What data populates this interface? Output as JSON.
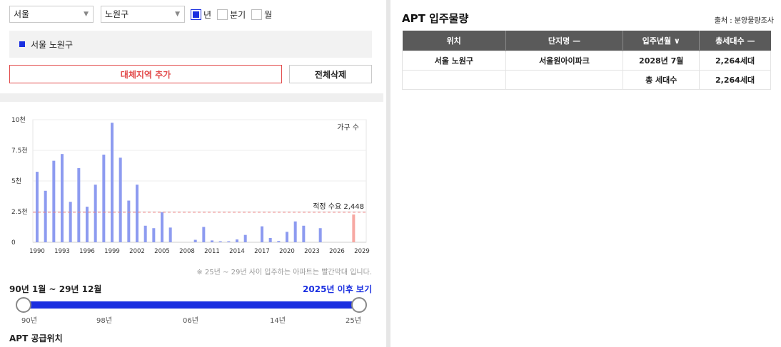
{
  "filters": {
    "province": "서울",
    "district": "노원구",
    "period_options": [
      {
        "label": "년",
        "checked": true
      },
      {
        "label": "분기",
        "checked": false
      },
      {
        "label": "월",
        "checked": false
      }
    ]
  },
  "selected_region": "서울 노원구",
  "buttons": {
    "add_region": "대체지역 추가",
    "delete_all": "전체삭제"
  },
  "chart_data": {
    "type": "bar",
    "legend_label": "가구 수",
    "yticks": [
      "10천",
      "7.5천",
      "5천",
      "2.5천",
      "0"
    ],
    "ylim": [
      0,
      10000
    ],
    "xticks": [
      "1990",
      "1993",
      "1996",
      "1999",
      "2002",
      "2005",
      "2008",
      "2011",
      "2014",
      "2017",
      "2020",
      "2023",
      "2026",
      "2029"
    ],
    "x": [
      1990,
      1991,
      1992,
      1993,
      1994,
      1995,
      1996,
      1997,
      1998,
      1999,
      2000,
      2001,
      2002,
      2003,
      2004,
      2005,
      2006,
      2007,
      2008,
      2009,
      2010,
      2011,
      2012,
      2013,
      2014,
      2015,
      2016,
      2017,
      2018,
      2019,
      2020,
      2021,
      2022,
      2023,
      2024,
      2025,
      2026,
      2027,
      2028
    ],
    "values": [
      5750,
      4200,
      6650,
      7200,
      3300,
      6050,
      2900,
      4700,
      7150,
      9750,
      6900,
      3400,
      4700,
      1350,
      1150,
      2450,
      1200,
      0,
      0,
      200,
      1250,
      150,
      80,
      80,
      230,
      600,
      0,
      1300,
      350,
      100,
      850,
      1700,
      1350,
      0,
      1150,
      0,
      0,
      0,
      2264
    ],
    "highlight_from": 2025,
    "bar_color": "#8d9bf0",
    "highlight_color": "#f7a9a3",
    "reference_line": {
      "value": 2448,
      "label": "적정 수요 2,448",
      "color": "#f08080"
    }
  },
  "note": "※ 25년 ~ 29년 사이 입주하는 아파트는 빨간막대 입니다.",
  "period_label": "90년 1월 ~ 29년 12월",
  "after_2025_link": "2025년 이후 보기",
  "slider": {
    "range": [
      1990,
      2025
    ],
    "labels": [
      "90년",
      "98년",
      "06년",
      "14년",
      "25년"
    ]
  },
  "location_section_title": "APT 공급위치",
  "right_panel": {
    "title": "APT 입주물량",
    "source": "출처 : 분양물량조사",
    "columns": [
      "위치",
      "단지명 —",
      "입주년월 ∨",
      "총세대수 —"
    ],
    "rows": [
      [
        "서울 노원구",
        "서울원아이파크",
        "2028년 7월",
        "2,264세대"
      ],
      [
        "",
        "",
        "총 세대수",
        "2,264세대"
      ]
    ]
  }
}
